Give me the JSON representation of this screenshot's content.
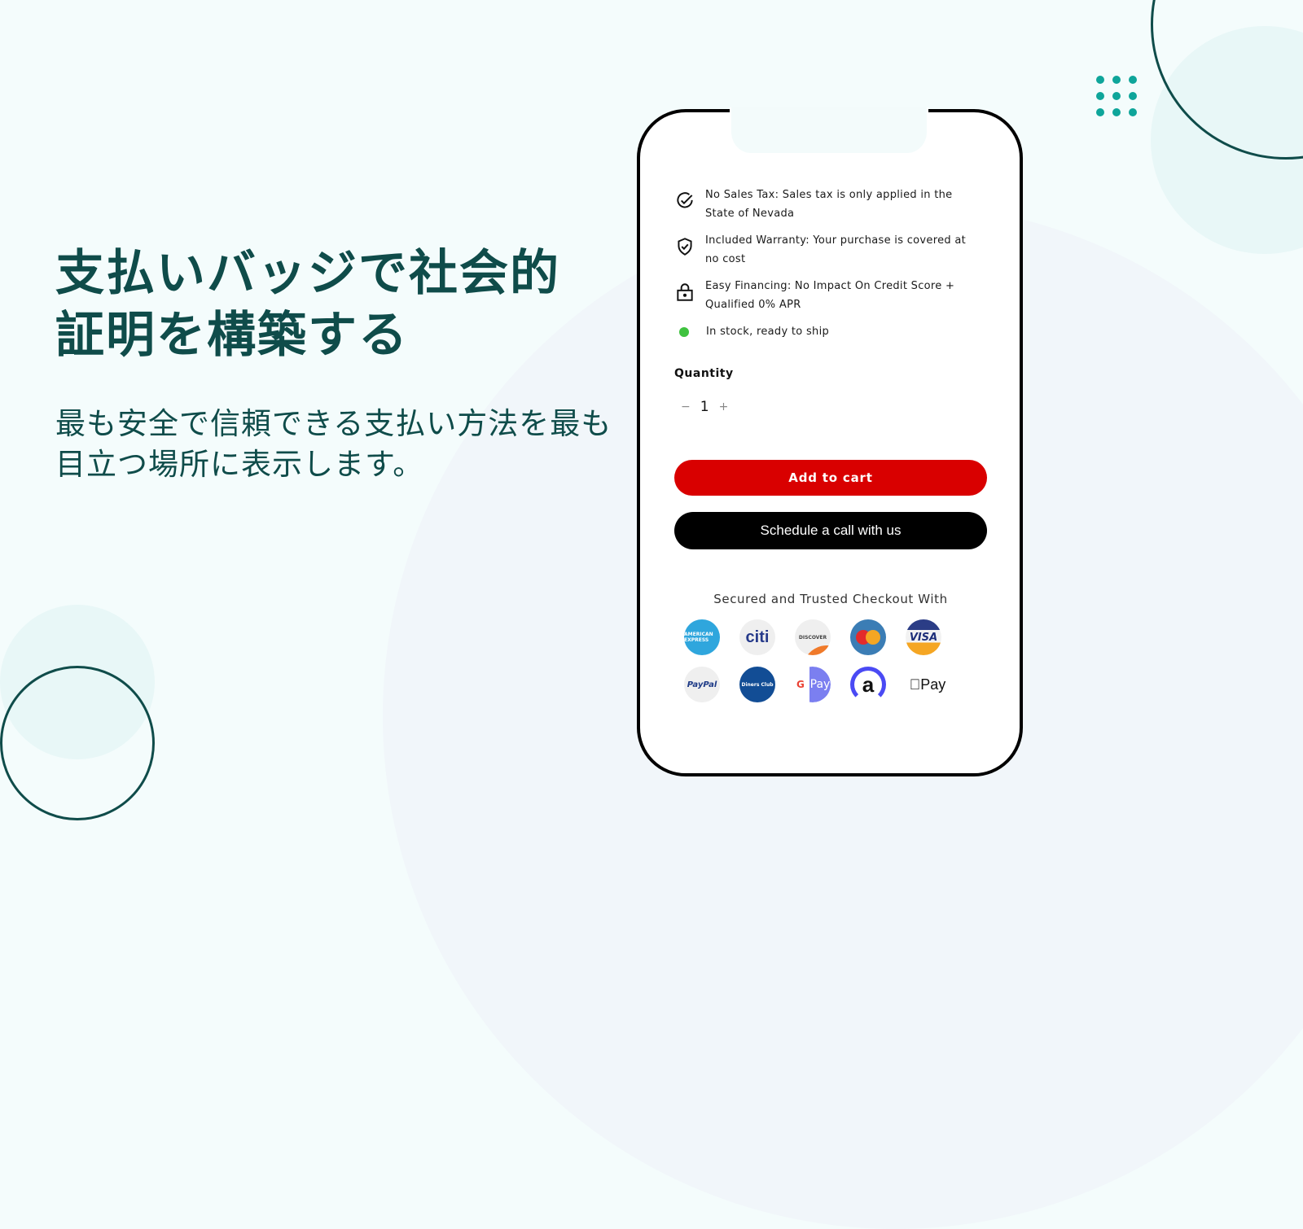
{
  "hero": {
    "headline": "支払いバッジで社会的証明を構築する",
    "subtext": "最も安全で信頼できる支払い方法を最も目立つ場所に表示します。"
  },
  "product": {
    "features": [
      {
        "icon": "check-circle-icon",
        "text": "No Sales Tax: Sales tax is only applied in the State of Nevada"
      },
      {
        "icon": "shield-check-icon",
        "text": "Included Warranty: Your purchase is covered at no cost"
      },
      {
        "icon": "lock-icon",
        "text": "Easy Financing: No Impact On Credit Score + Qualified 0% APR"
      }
    ],
    "stock_status": "In stock, ready to ship",
    "stock_color": "#3fc23f",
    "quantity_label": "Quantity",
    "quantity_value": "1",
    "decrement": "−",
    "increment": "+",
    "add_to_cart": "Add to cart",
    "add_to_cart_color": "#d90000",
    "schedule_call": "Schedule a call with us",
    "secured_title": "Secured and Trusted Checkout With",
    "payment_methods": [
      {
        "name": "American Express",
        "label": "AMERICAN EXPRESS"
      },
      {
        "name": "Citi",
        "label": "citi"
      },
      {
        "name": "Discover",
        "label": "DISCOVER"
      },
      {
        "name": "Mastercard",
        "label": ""
      },
      {
        "name": "Visa",
        "label": "VISA"
      },
      {
        "name": "PayPal",
        "label": "PayPal"
      },
      {
        "name": "Diners Club",
        "label": "Diners Club"
      },
      {
        "name": "Google Pay",
        "label": "Pay",
        "g": "G"
      },
      {
        "name": "Affirm",
        "label": "a"
      },
      {
        "name": "Apple Pay",
        "label": "Pay"
      }
    ]
  },
  "colors": {
    "brand_dark": "#0f4c4a",
    "accent_teal": "#0ea59a",
    "background": "#f4fcfc"
  }
}
